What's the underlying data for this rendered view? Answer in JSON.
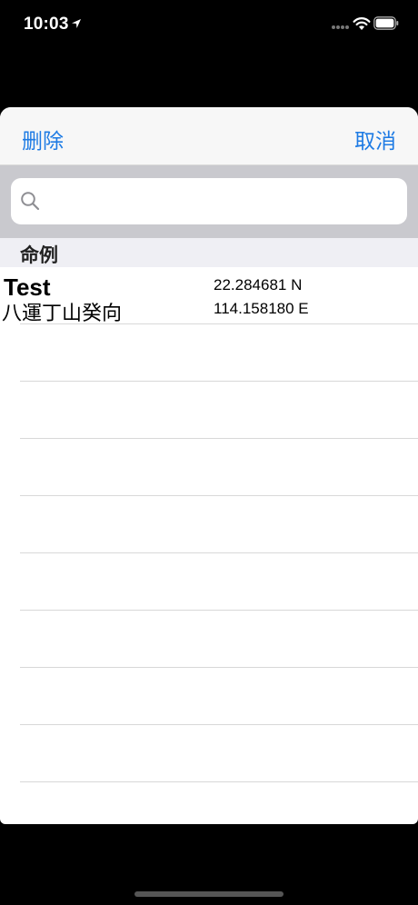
{
  "status_bar": {
    "time": "10:03",
    "icons": [
      "location-arrow-icon",
      "signal-dots-icon",
      "wifi-icon",
      "battery-icon"
    ]
  },
  "nav": {
    "delete_label": "删除",
    "cancel_label": "取消",
    "accent_color": "#1e7be4"
  },
  "search": {
    "value": "",
    "icon": "search-icon"
  },
  "section": {
    "title": "命例"
  },
  "rows": [
    {
      "title": "Test",
      "subtitle": "八運丁山癸向",
      "latitude": "22.284681 N",
      "longitude": "114.158180 E"
    }
  ],
  "colors": {
    "background": "#000000",
    "sheet": "#ffffff",
    "nav_bar": "#f7f7f7",
    "search_area": "#c9c9ce",
    "section_header": "#efeff4",
    "separator": "#d8d8d8"
  }
}
